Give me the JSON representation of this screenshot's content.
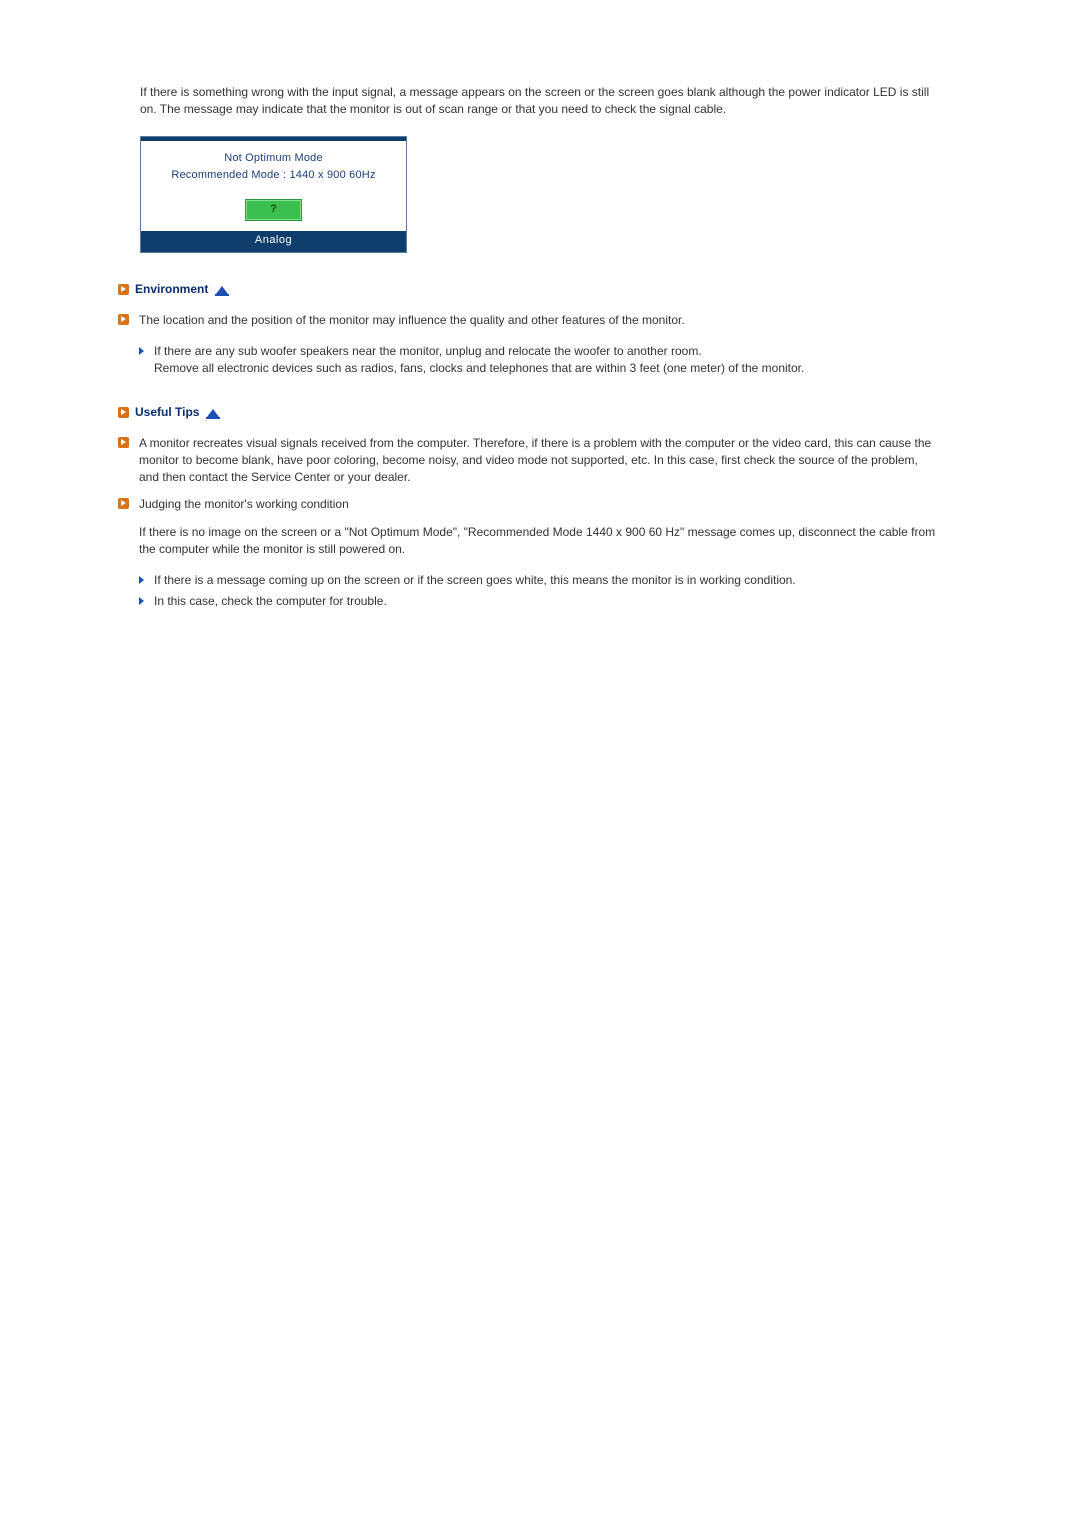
{
  "intro": "If there is something wrong with the input signal, a message appears on the screen or the screen goes blank although the power indicator LED is still on. The message may indicate that the monitor is out of scan range or that you need to check the signal cable.",
  "dialog": {
    "line1": "Not Optimum Mode",
    "line2": "Recommended Mode : 1440 x 900 60Hz",
    "button": "?",
    "footer": "Analog"
  },
  "environment": {
    "heading": "Environment",
    "item1": "The location and the position of the monitor may influence the quality and other features of the monitor.",
    "sub1a": "If there are any sub woofer speakers near the monitor, unplug and relocate the woofer to another room.",
    "sub1b": "Remove all electronic devices such as radios, fans, clocks and telephones that are within 3 feet (one meter) of the monitor."
  },
  "tips": {
    "heading": "Useful Tips",
    "item1": "A monitor recreates visual signals received from the computer. Therefore, if there is a problem with the computer or the video card, this can cause the monitor to become blank, have poor coloring, become noisy, and video mode not supported, etc. In this case, first check the source of the problem, and then contact the Service Center or your dealer.",
    "item2_title": "Judging the monitor's working condition",
    "item2_body": "If there is no image on the screen or a \"Not Optimum Mode\", \"Recommended Mode 1440 x 900 60 Hz\" message comes up, disconnect the cable from the computer while the monitor is still powered on.",
    "sub2a": "If there is a message coming up on the screen or if the screen goes white, this means the monitor is in working condition.",
    "sub2b": "In this case, check the computer for trouble."
  }
}
